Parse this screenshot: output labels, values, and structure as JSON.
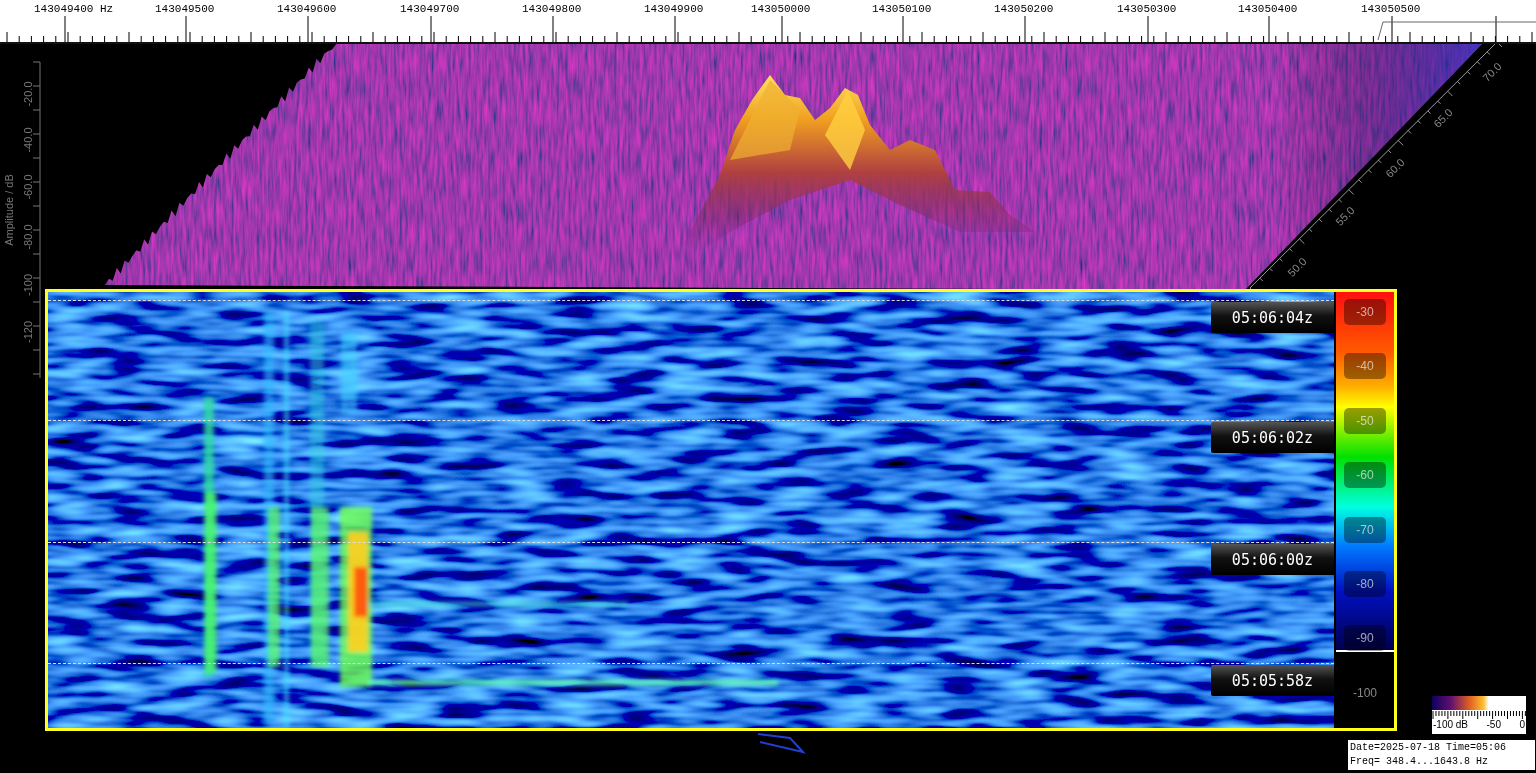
{
  "frequency_axis": {
    "labels": [
      "143049400 Hz",
      "143049500",
      "143049600",
      "143049700",
      "143049800",
      "143049900",
      "143050000",
      "143050100",
      "143050200",
      "143050300",
      "143050400",
      "143050500"
    ]
  },
  "amplitude_axis": {
    "title": "Amplitude / dB",
    "ticks": [
      "-20.0",
      "-40.0",
      "-60.0",
      "-80.0",
      "-100",
      "-120"
    ]
  },
  "time_depth_axis": {
    "ticks": [
      "50.0",
      "55.0",
      "60.0",
      "65.0",
      "70.0"
    ]
  },
  "waterfall": {
    "time_labels": [
      "05:06:04z",
      "05:06:02z",
      "05:06:00z",
      "05:05:58z"
    ]
  },
  "color_scale": {
    "labels": [
      "-30",
      "-40",
      "-50",
      "-60",
      "-70",
      "-80",
      "-90",
      "-100"
    ]
  },
  "amplitude_legend": {
    "labels": [
      "-100 dB",
      "-50",
      "0"
    ]
  },
  "info": {
    "lines": [
      "Date=2025-07-18 Time=05:06",
      "Freq= 348.4...1643.8 Hz"
    ]
  }
}
